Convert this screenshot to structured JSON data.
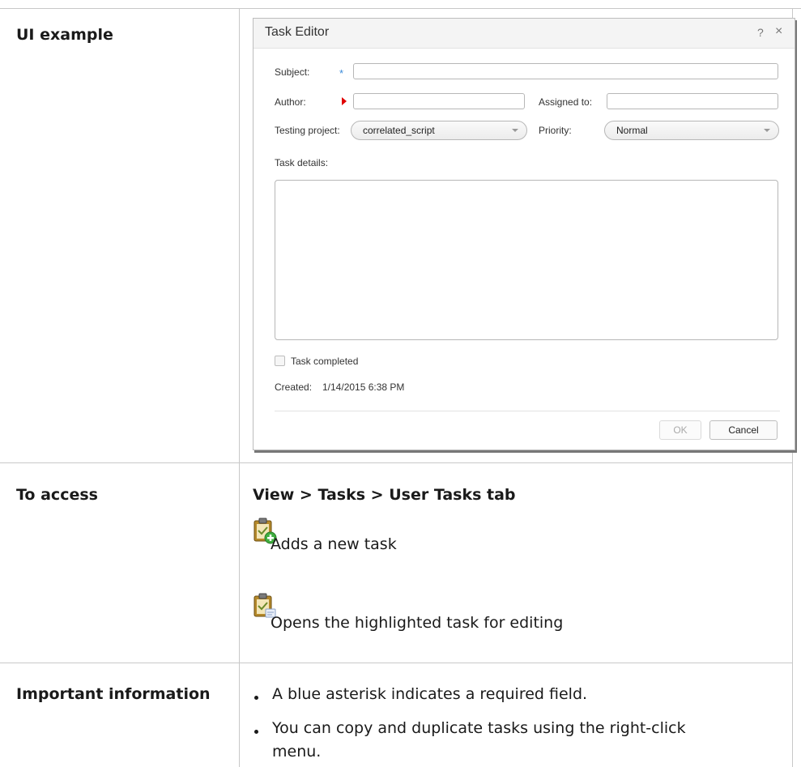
{
  "table": {
    "row_labels": {
      "ui_example": "UI example",
      "to_access": "To access",
      "important": "Important information"
    }
  },
  "dialog": {
    "title": "Task Editor",
    "help_glyph": "?",
    "close_glyph": "×",
    "fields": {
      "subject_label": "Subject:",
      "author_label": "Author:",
      "assigned_label": "Assigned to:",
      "project_label": "Testing project:",
      "project_value": "correlated_script",
      "priority_label": "Priority:",
      "priority_value": "Normal",
      "details_label": "Task details:",
      "subject_value": "",
      "author_value": "",
      "assigned_value": ""
    },
    "required_marker": "*",
    "task_completed_label": "Task completed",
    "task_completed_checked": false,
    "created_label": "Created:",
    "created_value": "1/14/2015 6:38 PM",
    "buttons": {
      "ok": "OK",
      "cancel": "Cancel"
    }
  },
  "access": {
    "path": "View > Tasks > User Tasks tab",
    "tools": [
      {
        "icon": "add-task-icon",
        "description": "Adds a new task"
      },
      {
        "icon": "edit-task-icon",
        "description": "Opens the highlighted task for editing"
      }
    ]
  },
  "important": {
    "items": [
      "A blue asterisk indicates a required field.",
      "You can copy and duplicate tasks using the right-click",
      "menu."
    ]
  },
  "colors": {
    "required_star": "#3b8ad9",
    "required_arrow": "#e00000",
    "grid": "#c8c8c8"
  }
}
